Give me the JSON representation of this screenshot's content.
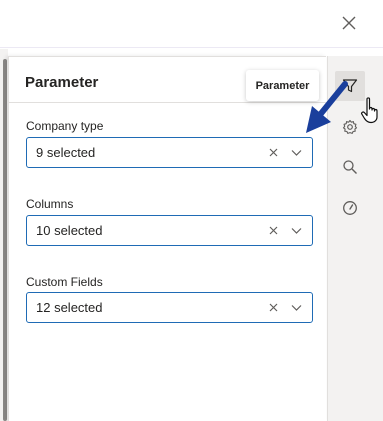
{
  "panel": {
    "title": "Parameter",
    "fields": [
      {
        "label": "Company type",
        "value": "9 selected"
      },
      {
        "label": "Columns",
        "value": "10 selected"
      },
      {
        "label": "Custom Fields",
        "value": "12 selected"
      }
    ]
  },
  "tooltip": {
    "text": "Parameter"
  },
  "rail": {
    "icons": [
      "filter-icon",
      "gear-icon",
      "search-icon",
      "speedometer-icon"
    ],
    "active": "filter-icon"
  },
  "colors": {
    "accent": "#1f6bb5",
    "annotation_arrow": "#1a3f9c",
    "panel_bg": "#ffffff",
    "rail_bg": "#f3f2f1"
  }
}
